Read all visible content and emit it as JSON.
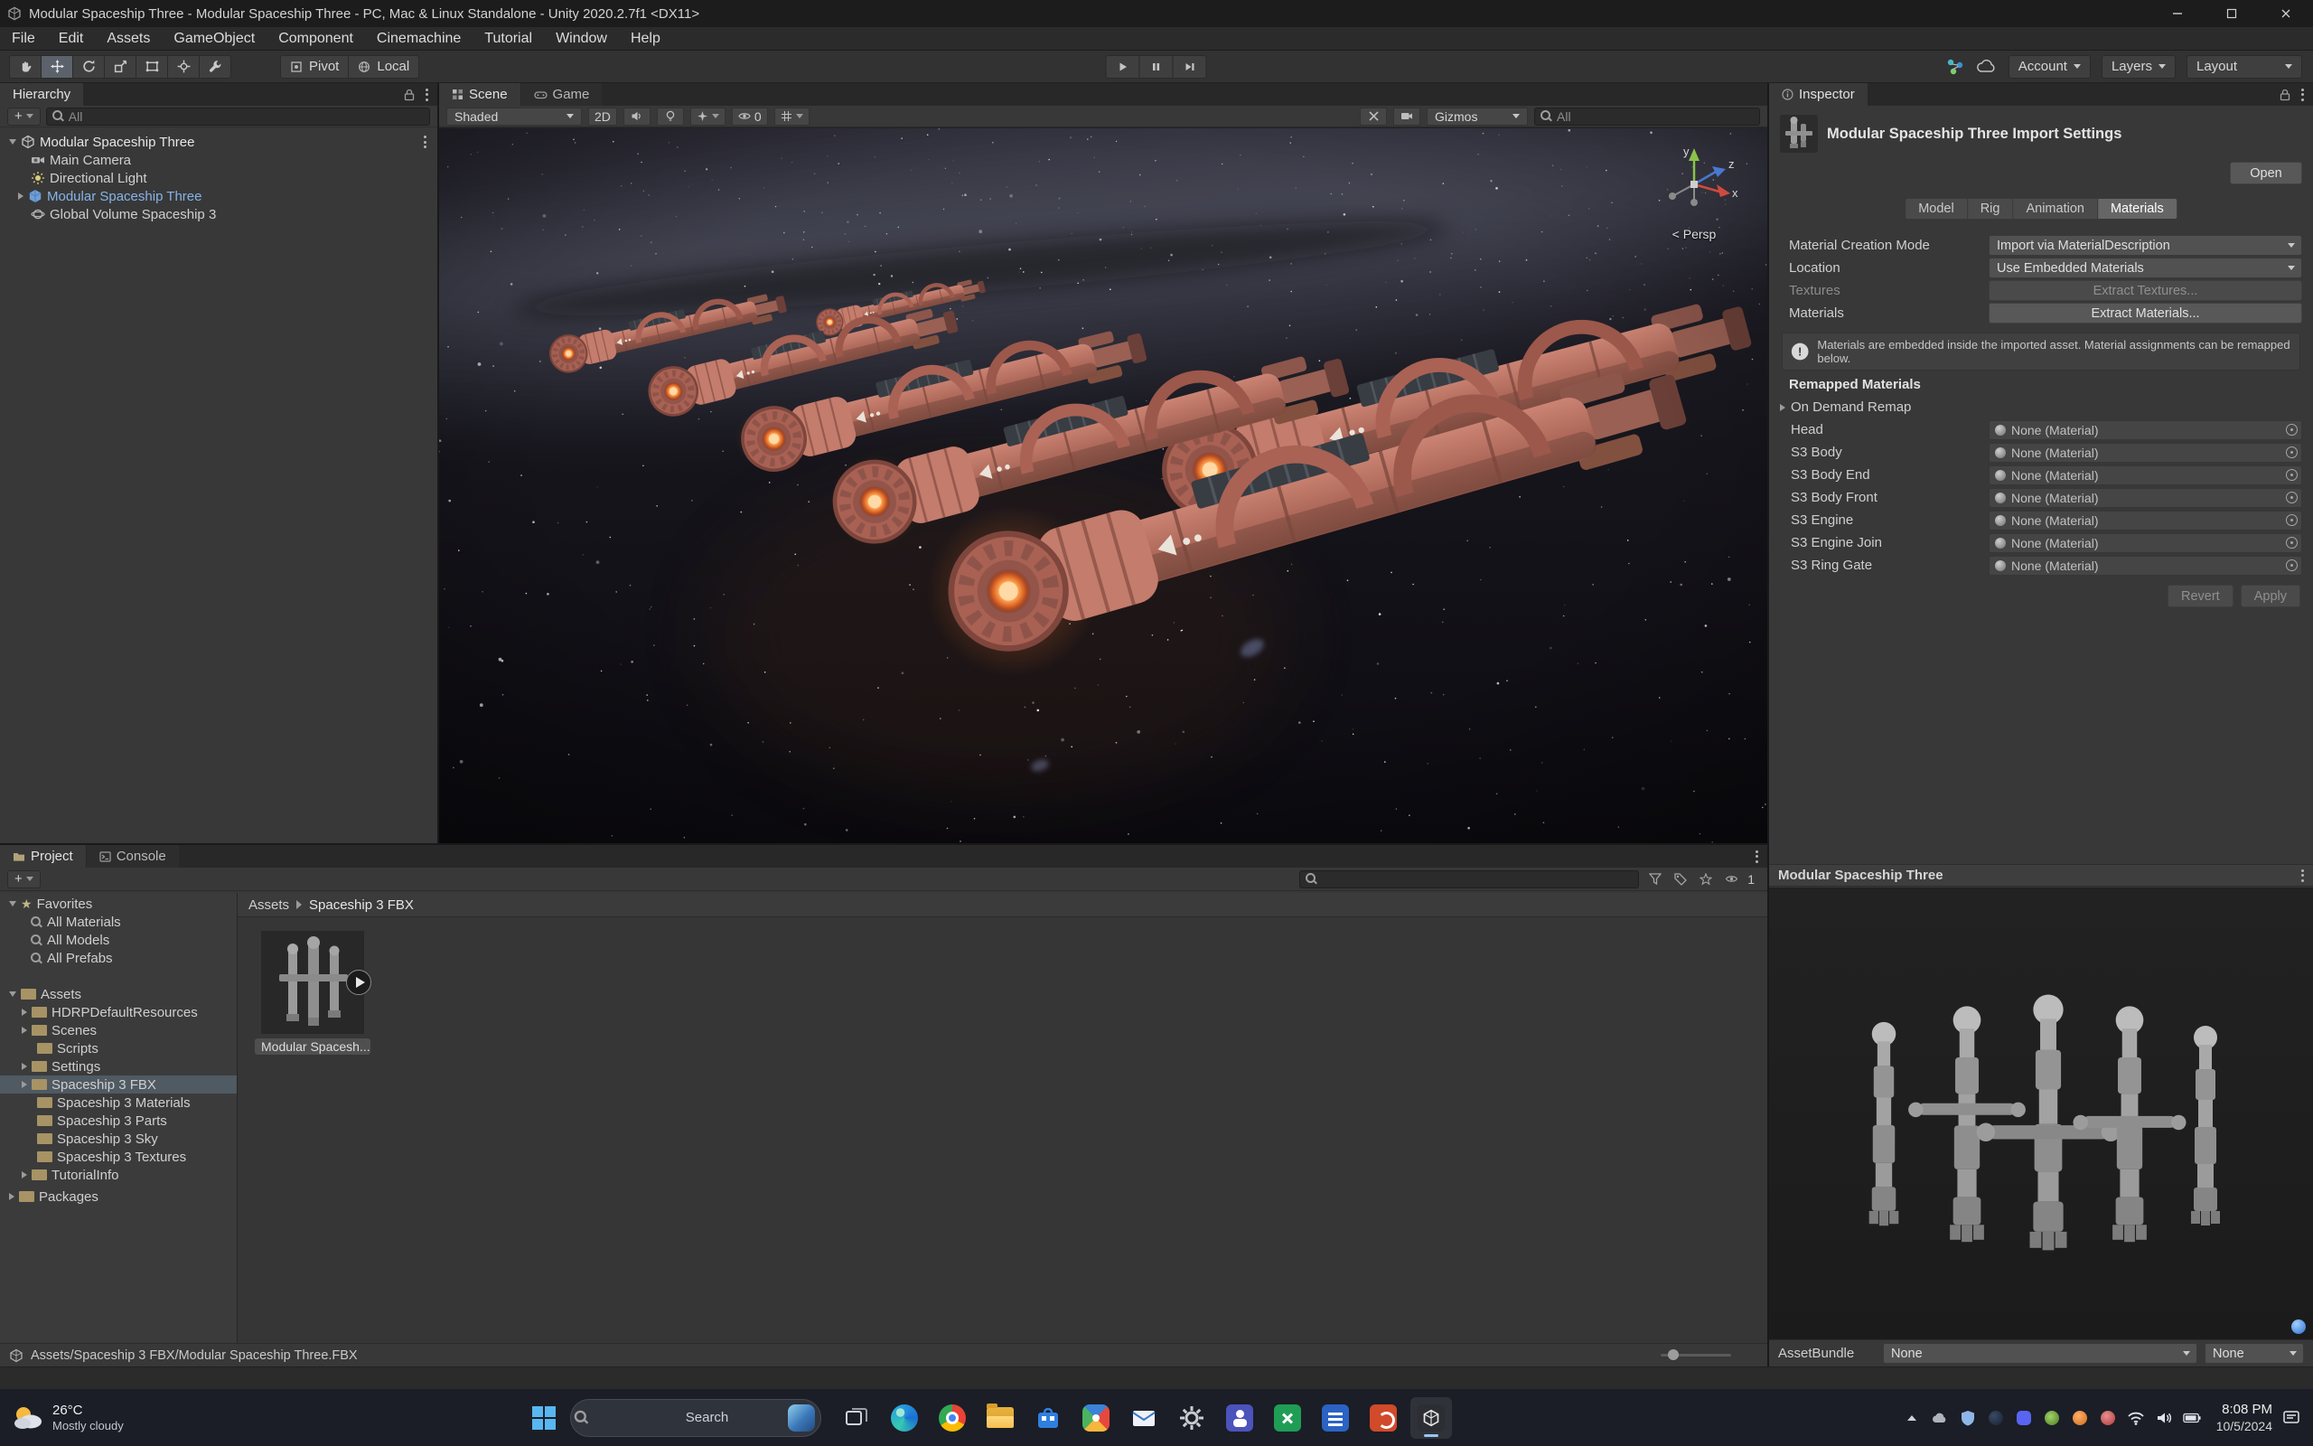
{
  "window": {
    "title": "Modular Spaceship Three - Modular Spaceship Three - PC, Mac & Linux Standalone - Unity 2020.2.7f1 <DX11>"
  },
  "menu": {
    "items": [
      "File",
      "Edit",
      "Assets",
      "GameObject",
      "Component",
      "Cinemachine",
      "Tutorial",
      "Window",
      "Help"
    ]
  },
  "toolbar": {
    "pivot_label": "Pivot",
    "local_label": "Local",
    "account_label": "Account",
    "layers_label": "Layers",
    "layout_label": "Layout"
  },
  "hierarchy": {
    "tab": "Hierarchy",
    "search_placeholder": "All",
    "scene_name": "Modular Spaceship Three",
    "items": [
      {
        "label": "Main Camera"
      },
      {
        "label": "Directional Light"
      },
      {
        "label": "Modular Spaceship Three"
      },
      {
        "label": "Global Volume Spaceship 3"
      }
    ]
  },
  "scene_view": {
    "tabs": [
      "Scene",
      "Game"
    ],
    "draw_mode": "Shaded",
    "toggle_2d": "2D",
    "hidden_count": "0",
    "gizmos_label": "Gizmos",
    "search_placeholder": "All",
    "camera_label": "< Persp",
    "axis_labels": {
      "x": "x",
      "y": "y",
      "z": "z"
    }
  },
  "inspector": {
    "tab": "Inspector",
    "title": "Modular Spaceship Three Import Settings",
    "open_button": "Open",
    "tabs": [
      "Model",
      "Rig",
      "Animation",
      "Materials"
    ],
    "rows": {
      "creation_mode_label": "Material Creation Mode",
      "creation_mode_value": "Import via MaterialDescription",
      "location_label": "Location",
      "location_value": "Use Embedded Materials",
      "textures_label": "Textures",
      "textures_button": "Extract Textures...",
      "materials_label": "Materials",
      "materials_button": "Extract Materials..."
    },
    "info_text": "Materials are embedded inside the imported asset. Material assignments can be remapped below.",
    "remapped_title": "Remapped Materials",
    "on_demand_label": "On Demand Remap",
    "remapped": [
      {
        "label": "Head",
        "value": "None (Material)"
      },
      {
        "label": "S3 Body",
        "value": "None (Material)"
      },
      {
        "label": "S3 Body End",
        "value": "None (Material)"
      },
      {
        "label": "S3 Body Front",
        "value": "None (Material)"
      },
      {
        "label": "S3 Engine",
        "value": "None (Material)"
      },
      {
        "label": "S3 Engine Join",
        "value": "None (Material)"
      },
      {
        "label": "S3 Ring Gate",
        "value": "None (Material)"
      }
    ],
    "revert_button": "Revert",
    "apply_button": "Apply",
    "preview_title": "Modular Spaceship Three",
    "assetbundle_label": "AssetBundle",
    "assetbundle_value": "None",
    "assetbundle_variant": "None"
  },
  "project": {
    "tabs": [
      "Project",
      "Console"
    ],
    "favorites_label": "Favorites",
    "favorites": [
      {
        "label": "All Materials"
      },
      {
        "label": "All Models"
      },
      {
        "label": "All Prefabs"
      }
    ],
    "assets_label": "Assets",
    "folders": [
      {
        "label": "HDRPDefaultResources"
      },
      {
        "label": "Scenes"
      },
      {
        "label": "Scripts"
      },
      {
        "label": "Settings"
      },
      {
        "label": "Spaceship 3 FBX"
      },
      {
        "label": "Spaceship 3 Materials"
      },
      {
        "label": "Spaceship 3 Parts"
      },
      {
        "label": "Spaceship 3 Sky"
      },
      {
        "label": "Spaceship 3 Textures"
      },
      {
        "label": "TutorialInfo"
      }
    ],
    "packages_label": "Packages",
    "breadcrumb": {
      "root": "Assets",
      "current": "Spaceship 3 FBX"
    },
    "asset_label": "Modular Spacesh...",
    "hidden_count": "1",
    "status_path": "Assets/Spaceship 3 FBX/Modular Spaceship Three.FBX"
  },
  "taskbar": {
    "weather_temp": "26°C",
    "weather_desc": "Mostly cloudy",
    "search_placeholder": "Search",
    "clock_time": "8:08 PM",
    "clock_date": "10/5/2024"
  }
}
